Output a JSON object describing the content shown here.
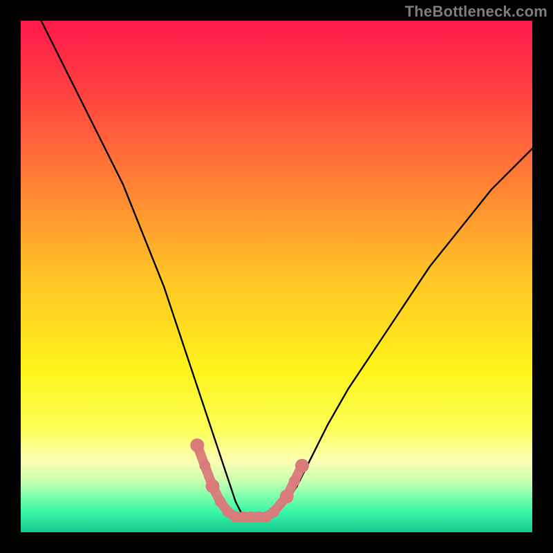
{
  "watermark": {
    "text": "TheBottleneck.com"
  },
  "chart_data": {
    "type": "line",
    "title": "",
    "xlabel": "",
    "ylabel": "",
    "xlim": [
      0,
      100
    ],
    "ylim": [
      0,
      100
    ],
    "gradient_stops": [
      {
        "pct": 0,
        "color": "#ff1a4b"
      },
      {
        "pct": 12,
        "color": "#ff3b42"
      },
      {
        "pct": 30,
        "color": "#ff7a36"
      },
      {
        "pct": 50,
        "color": "#ffc425"
      },
      {
        "pct": 68,
        "color": "#fef31a"
      },
      {
        "pct": 80,
        "color": "#fbff59"
      },
      {
        "pct": 86,
        "color": "#fdffb4"
      },
      {
        "pct": 90,
        "color": "#c8ffb0"
      },
      {
        "pct": 93,
        "color": "#7dffac"
      },
      {
        "pct": 96,
        "color": "#37f7a8"
      },
      {
        "pct": 100,
        "color": "#17c88f"
      }
    ],
    "series": [
      {
        "name": "bottleneck-curve",
        "x": [
          4,
          6,
          8,
          10,
          12,
          14,
          16,
          18,
          20,
          22,
          24,
          26,
          28,
          30,
          32,
          34,
          36,
          38,
          40,
          41,
          42,
          43,
          44,
          45,
          46,
          48,
          50,
          52,
          54,
          56,
          58,
          60,
          64,
          68,
          72,
          76,
          80,
          84,
          88,
          92,
          96,
          100
        ],
        "y": [
          100,
          96,
          92,
          88,
          84,
          80,
          76,
          72,
          68,
          63,
          58,
          53,
          48,
          42,
          36,
          30,
          24,
          18,
          12,
          9,
          6,
          4,
          3,
          3,
          3,
          3,
          4,
          6,
          9,
          13,
          17,
          21,
          28,
          34,
          40,
          46,
          52,
          57,
          62,
          67,
          71,
          75
        ]
      }
    ],
    "markers": {
      "name": "highlighted-points",
      "color": "#d97b7b",
      "points": [
        {
          "x": 34.5,
          "y": 17
        },
        {
          "x": 36,
          "y": 13
        },
        {
          "x": 37.5,
          "y": 9
        },
        {
          "x": 39,
          "y": 6
        },
        {
          "x": 40.5,
          "y": 4
        },
        {
          "x": 42,
          "y": 3
        },
        {
          "x": 43.5,
          "y": 3
        },
        {
          "x": 45,
          "y": 3
        },
        {
          "x": 46.5,
          "y": 3
        },
        {
          "x": 48,
          "y": 3
        },
        {
          "x": 49.5,
          "y": 4
        },
        {
          "x": 52,
          "y": 7
        },
        {
          "x": 53.5,
          "y": 10
        },
        {
          "x": 55,
          "y": 13
        }
      ]
    }
  }
}
